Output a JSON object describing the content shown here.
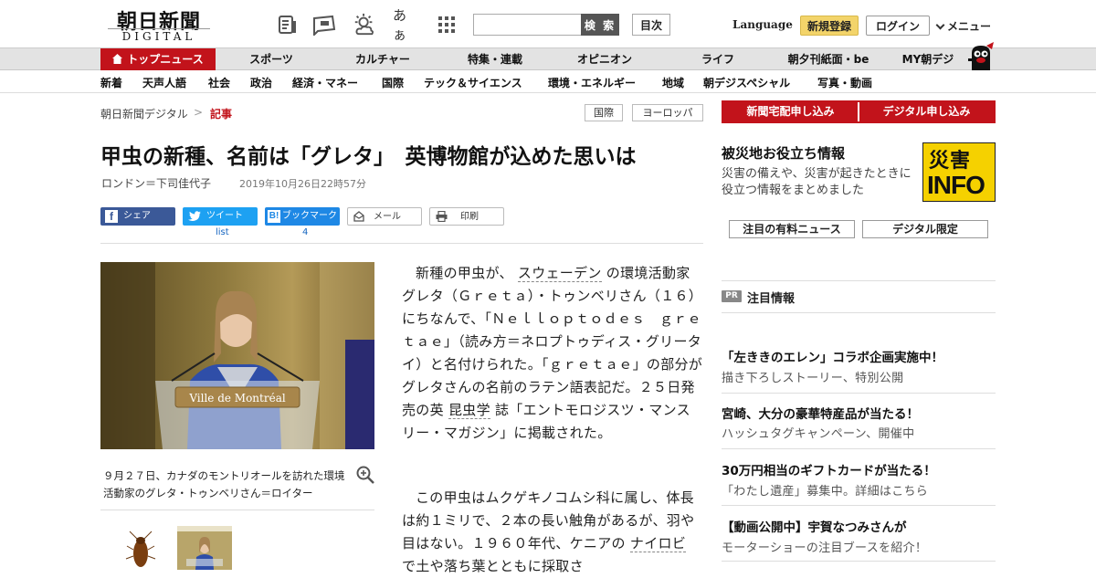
{
  "header": {
    "logo_main": "朝日新聞",
    "logo_sub": "DIGITAL",
    "icons": [
      "newspaper-icon",
      "message-icon",
      "weather-icon",
      "text-size-icon",
      "grid-icon"
    ],
    "font_size_label": "あぁ",
    "search_placeholder": "",
    "search_button": "検 索",
    "toc_button": "目次",
    "language": "Language",
    "signup": "新規登録",
    "login": "ログイン",
    "menu": "メニュー"
  },
  "nav_primary": {
    "items": [
      "トップニュース",
      "スポーツ",
      "カルチャー",
      "特集・連載",
      "オピニオン",
      "ライフ",
      "朝夕刊紙面・be",
      "MY朝デジ"
    ],
    "active_color": "#c2131b"
  },
  "nav_secondary": {
    "items": [
      "新着",
      "天声人語",
      "社会",
      "政治",
      "経済・マネー",
      "国際",
      "テック＆サイエンス",
      "環境・エネルギー",
      "地域",
      "朝デジスペシャル",
      "写真・動画"
    ]
  },
  "breadcrumb": {
    "home": "朝日新聞デジタル",
    "separator": ">",
    "current": "記事"
  },
  "tags": [
    "国際",
    "ヨーロッパ"
  ],
  "article": {
    "title": "甲虫の新種、名前は「グレタ」　英博物館が込めた思いは",
    "byline": "ロンドン＝下司佳代子",
    "date": "2019年10月26日22時57分",
    "share": {
      "facebook": "シェア",
      "twitter": "ツイート",
      "twitter_count": "list",
      "hatena": "ブックマーク",
      "hatena_count": "4",
      "mail": "メール",
      "print": "印刷"
    },
    "photo_sign": "Ville de Montréal",
    "caption": "９月２７日、カナダのモントリオールを訪れた環境活動家のグレタ・トゥンベリさん＝ロイター",
    "p1_a": "新種の甲虫が、",
    "p1_link1": "スウェーデン",
    "p1_b": "の環境活動家グレタ（Ｇｒｅｔａ）・トゥンベリさん（１６）にちなんで、「Ｎｅｌｌｏｐｔｏｄｅｓ　ｇｒｅｔａｅ」（読み方＝ネロプトゥディス・グリータイ）と名付けられた。「ｇｒｅｔａｅ」の部分がグレタさんの名前のラテン語表記だ。２５日発売の英",
    "p1_link2": "昆虫学",
    "p1_c": "誌「エントモロジスツ・マンスリー・マガジン」に掲載された。",
    "p2_a": "この甲虫はムクゲキノコムシ科に属し、体長は約１ミリで、２本の長い触角があるが、羽や目はない。１９６０年代、ケニアの",
    "p2_link": "ナイロビ",
    "p2_b": "で土や落ち葉とともに採取さ"
  },
  "sidebar": {
    "btn_delivery": "新聞宅配申し込み",
    "btn_digital": "デジタル申し込み",
    "disaster_title": "被災地お役立ち情報",
    "disaster_desc": "災害の備えや、災害が起きたときに役立つ情報をまとめました",
    "disaster_logo_top": "災害",
    "disaster_logo_bottom": "INFO",
    "tab_paid": "注目の有料ニュース",
    "tab_digital": "デジタル限定",
    "pr_badge": "PR",
    "pr_heading": "注目情報",
    "pr_items": [
      {
        "title": "「左ききのエレン」コラボ企画実施中！",
        "desc": "描き下ろしストーリー、特別公開"
      },
      {
        "title": "宮崎、大分の豪華特産品が当たる！",
        "desc": "ハッシュタグキャンペーン、開催中"
      },
      {
        "title": "30万円相当のギフトカードが当たる！",
        "desc": "「わたし遺産」募集中。詳細はこちら"
      },
      {
        "title": "【動画公開中】宇賀なつみさんが",
        "desc": "モーターショーの注目ブースを紹介！"
      }
    ]
  },
  "colors": {
    "brand_red": "#c2131b",
    "facebook": "#3b5998",
    "twitter": "#1da1f2",
    "hatena": "#1e88e5",
    "signup_yellow": "#f3d46a",
    "disaster_yellow": "#f5d100"
  }
}
